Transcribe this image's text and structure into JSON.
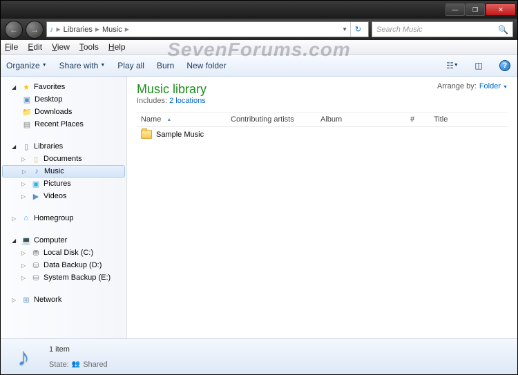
{
  "watermark": "SevenForums.com",
  "titlebar": {
    "min": "—",
    "max": "❐",
    "close": "✕"
  },
  "nav": {
    "back": "←",
    "forward": "→"
  },
  "address": {
    "icon": "♪",
    "segments": [
      "Libraries",
      "Music"
    ],
    "refresh": "↻"
  },
  "search": {
    "placeholder": "Search Music",
    "icon": "🔍"
  },
  "menubar": {
    "file": "File",
    "edit": "Edit",
    "view": "View",
    "tools": "Tools",
    "help": "Help"
  },
  "toolbar": {
    "organize": "Organize",
    "share": "Share with",
    "playall": "Play all",
    "burn": "Burn",
    "newfolder": "New folder",
    "help": "?"
  },
  "sidebar": {
    "favorites": {
      "label": "Favorites",
      "items": [
        {
          "label": "Desktop",
          "icon": "desk"
        },
        {
          "label": "Downloads",
          "icon": "dl"
        },
        {
          "label": "Recent Places",
          "icon": "recent"
        }
      ]
    },
    "libraries": {
      "label": "Libraries",
      "items": [
        {
          "label": "Documents",
          "icon": "doc"
        },
        {
          "label": "Music",
          "icon": "mus",
          "selected": true
        },
        {
          "label": "Pictures",
          "icon": "pic"
        },
        {
          "label": "Videos",
          "icon": "vid"
        }
      ]
    },
    "homegroup": {
      "label": "Homegroup"
    },
    "computer": {
      "label": "Computer",
      "items": [
        {
          "label": "Local Disk (C:)",
          "icon": "drive"
        },
        {
          "label": "Data Backup (D:)",
          "icon": "drive"
        },
        {
          "label": "System Backup (E:)",
          "icon": "drive"
        }
      ]
    },
    "network": {
      "label": "Network"
    }
  },
  "library": {
    "title": "Music library",
    "includes_label": "Includes:",
    "includes_link": "2 locations",
    "arrange_label": "Arrange by:",
    "arrange_value": "Folder"
  },
  "columns": {
    "name": "Name",
    "artist": "Contributing artists",
    "album": "Album",
    "num": "#",
    "title": "Title"
  },
  "files": [
    {
      "name": "Sample Music",
      "type": "folder"
    }
  ],
  "status": {
    "count": "1 item",
    "state_label": "State:",
    "state_value": "Shared"
  }
}
